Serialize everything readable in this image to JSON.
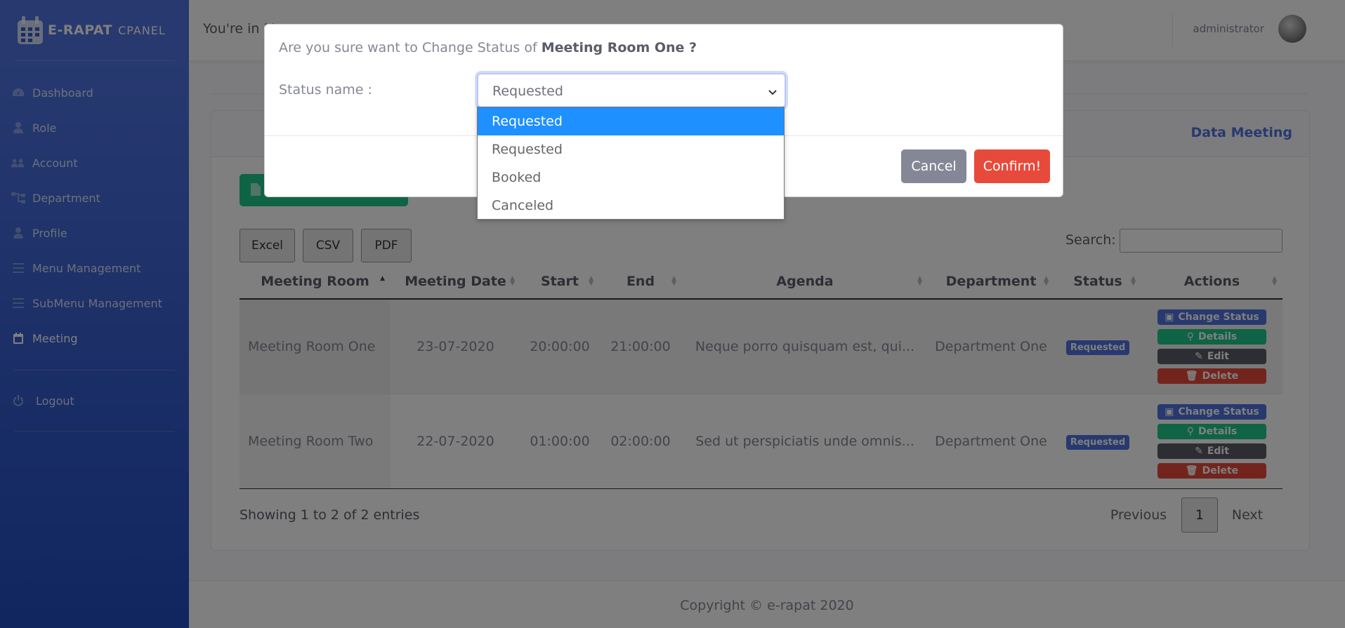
{
  "brand": {
    "name": "E-RAPAT",
    "sub": "CPANEL"
  },
  "sidebar": {
    "items": [
      {
        "label": "Dashboard",
        "icon": "tachometer-icon"
      },
      {
        "label": "Role",
        "icon": "user-icon"
      },
      {
        "label": "Account",
        "icon": "users-icon"
      },
      {
        "label": "Department",
        "icon": "sitemap-icon"
      },
      {
        "label": "Profile",
        "icon": "user-icon"
      },
      {
        "label": "Menu Management",
        "icon": "bars-icon"
      },
      {
        "label": "SubMenu Management",
        "icon": "bars-icon"
      },
      {
        "label": "Meeting",
        "icon": "calendar-icon",
        "active": true
      }
    ],
    "logout": "Logout"
  },
  "topbar": {
    "crumb": "You're in M",
    "user": "administrator"
  },
  "card": {
    "title": "Data Meeting"
  },
  "export_buttons": [
    "Excel",
    "CSV",
    "PDF"
  ],
  "search": {
    "label": "Search:",
    "value": ""
  },
  "table": {
    "headers": [
      "Meeting Room",
      "Meeting Date",
      "Start",
      "End",
      "Agenda",
      "Department",
      "Status",
      "Actions"
    ],
    "rows": [
      {
        "room": "Meeting Room One",
        "date": "23-07-2020",
        "start": "20:00:00",
        "end": "21:00:00",
        "agenda": "Neque porro quisquam est, qui...",
        "department": "Department One",
        "status": "Requested"
      },
      {
        "room": "Meeting Room Two",
        "date": "22-07-2020",
        "start": "01:00:00",
        "end": "02:00:00",
        "agenda": "Sed ut perspiciatis unde omnis...",
        "department": "Department One",
        "status": "Requested"
      }
    ],
    "actions": {
      "change_status": "Change Status",
      "details": "Details",
      "edit": "Edit",
      "delete": "Delete"
    }
  },
  "pagination": {
    "info": "Showing 1 to 2 of 2 entries",
    "previous": "Previous",
    "page": "1",
    "next": "Next"
  },
  "footer": {
    "copyright": "Copyright © e-rapat 2020"
  },
  "modal": {
    "question_prefix": "Are you sure want to Change Status of ",
    "question_subject": "Meeting Room One ?",
    "status_label": "Status name :",
    "selected": "Requested",
    "options": [
      "Requested",
      "Requested",
      "Booked",
      "Canceled"
    ],
    "highlighted_index": 0,
    "cancel": "Cancel",
    "confirm": "Confirm!"
  },
  "colors": {
    "primary": "#4e73df",
    "success": "#1cc88a",
    "danger": "#e74a3b",
    "secondary": "#858796",
    "dark": "#5a5c69",
    "option_highlight": "#1e90ff"
  }
}
